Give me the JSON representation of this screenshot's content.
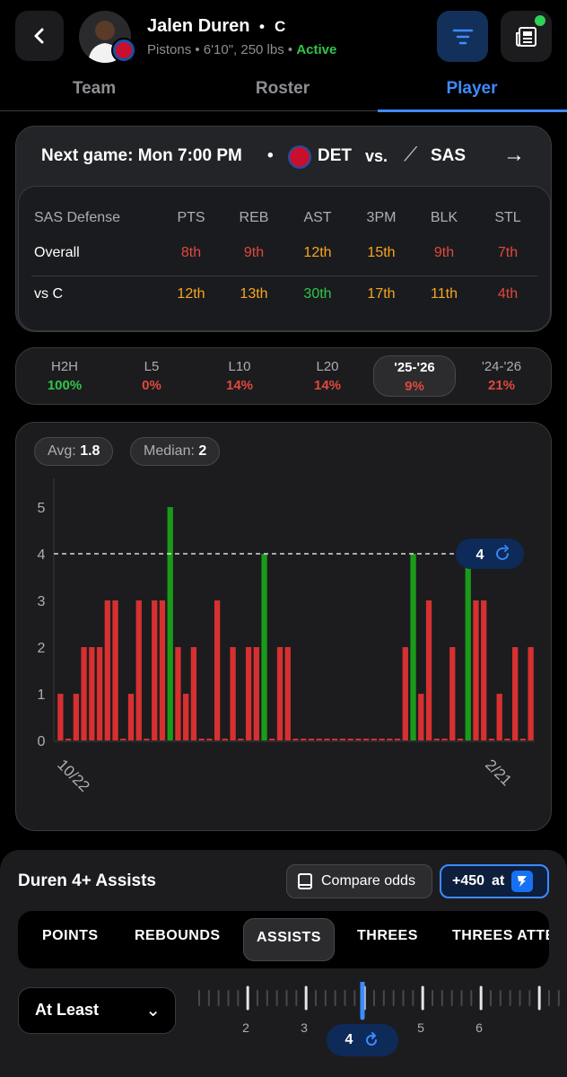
{
  "player": {
    "name": "Jalen Duren",
    "position": "C",
    "team": "Pistons",
    "height_weight": "6'10\", 250 lbs",
    "status": "Active"
  },
  "tabs": [
    "Team",
    "Roster",
    "Player"
  ],
  "next_game": {
    "label": "Next game: Mon 7:00 PM",
    "home": "DET",
    "vs": "vs.",
    "away": "SAS"
  },
  "defense": {
    "title": "SAS Defense",
    "columns": [
      "PTS",
      "REB",
      "AST",
      "3PM",
      "BLK",
      "STL"
    ],
    "rows": [
      {
        "label": "Overall",
        "values": [
          "8th",
          "9th",
          "12th",
          "15th",
          "9th",
          "7th"
        ],
        "colors": [
          "#e0483e",
          "#e0483e",
          "#f5a623",
          "#f5a623",
          "#e0483e",
          "#e0483e"
        ]
      },
      {
        "label": "vs C",
        "values": [
          "12th",
          "13th",
          "30th",
          "17th",
          "11th",
          "4th"
        ],
        "colors": [
          "#f5a623",
          "#f5a623",
          "#30c548",
          "#f5a623",
          "#f5a623",
          "#e0483e"
        ]
      }
    ]
  },
  "ranges": [
    {
      "label": "H2H",
      "pct": "100%",
      "color": "#30c548"
    },
    {
      "label": "L5",
      "pct": "0%",
      "color": "#e0483e"
    },
    {
      "label": "L10",
      "pct": "14%",
      "color": "#e0483e"
    },
    {
      "label": "L20",
      "pct": "14%",
      "color": "#e0483e"
    },
    {
      "label": "'25-'26",
      "pct": "9%",
      "color": "#e0483e"
    },
    {
      "label": "'24-'26",
      "pct": "21%",
      "color": "#e0483e"
    }
  ],
  "summary": {
    "avg_label": "Avg:",
    "avg": "1.8",
    "median_label": "Median:",
    "median": "2"
  },
  "chart_data": {
    "type": "bar",
    "first_label": "10/22",
    "last_label": "2/21",
    "y_ticks": [
      "0",
      "1",
      "2",
      "3",
      "4",
      "5"
    ],
    "ylim": [
      0,
      5
    ],
    "line_value": 4,
    "line_label": "4",
    "values": [
      1,
      0,
      1,
      2,
      2,
      2,
      3,
      3,
      0,
      1,
      3,
      0,
      3,
      3,
      5,
      2,
      1,
      2,
      0,
      0,
      3,
      0,
      2,
      0,
      2,
      2,
      4,
      0,
      2,
      2,
      0,
      0,
      0,
      0,
      0,
      0,
      0,
      0,
      0,
      0,
      0,
      0,
      0,
      0,
      2,
      4,
      1,
      3,
      0,
      0,
      2,
      0,
      4,
      3,
      3,
      0,
      1,
      0,
      2,
      0,
      2
    ]
  },
  "prop": {
    "title": "Duren 4+ Assists",
    "compare_label": "Compare odds",
    "odds": "+450",
    "odds_at": "at"
  },
  "stat_tabs": [
    "POINTS",
    "REBOUNDS",
    "ASSISTS",
    "THREES",
    "THREES ATTE"
  ],
  "selector": {
    "mode": "At Least",
    "ruler_labels": [
      "2",
      "3",
      "4",
      "5",
      "6"
    ],
    "value": "4"
  }
}
